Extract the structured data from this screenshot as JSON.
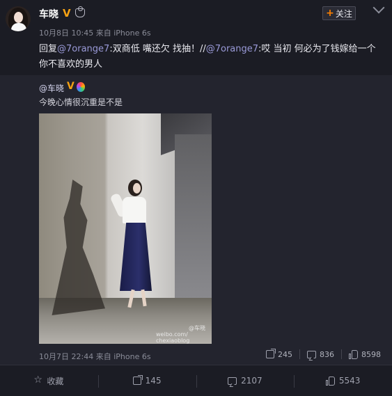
{
  "post": {
    "username": "车晓",
    "verified_badge": "V",
    "follow_label": "关注",
    "follow_plus": "+",
    "meta": {
      "date": "10月8日 10:45",
      "from_label": "来自",
      "client": "iPhone 6s"
    },
    "text": {
      "prefix": "回复",
      "mention1": "@7orange7",
      "part1": ":双商低 嘴还欠 找抽！//",
      "mention2": "@7orange7",
      "part2": ":哎 当初  何必为了钱嫁给一个你不喜欢的男人"
    }
  },
  "repost": {
    "username": "@车晓",
    "verified_badge": "V",
    "text": "今晚心情很沉重是不是",
    "watermark_handle": "@车晓",
    "watermark_url": "weibo.com/ chexiaoblog",
    "meta": {
      "date": "10月7日 22:44",
      "from_label": "来自",
      "client": "iPhone 6s"
    },
    "stats": {
      "reposts": "245",
      "comments": "836",
      "likes": "8598"
    }
  },
  "actions": {
    "favorite_label": "收藏",
    "reposts": "145",
    "comments": "2107",
    "likes": "5543"
  },
  "colors": {
    "background": "#1b1c24",
    "repost_background": "#23242e",
    "mention": "#9a9ad8",
    "verified": "#f3a013",
    "follow_plus": "#ff8200"
  },
  "icons": {
    "favorite": "star-icon",
    "repost": "share-icon",
    "comment": "comment-icon",
    "like": "thumbs-up-icon",
    "more": "chevron-down-icon",
    "member": "crown-icon",
    "rainbow": "rainbow-badge-icon"
  }
}
